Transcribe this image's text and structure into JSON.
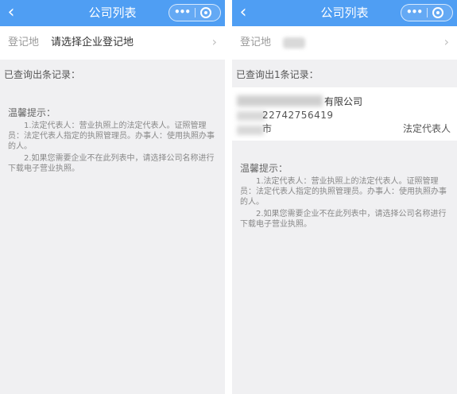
{
  "screens": [
    {
      "nav": {
        "title": "公司列表",
        "more_icon": "•••"
      },
      "registration": {
        "label": "登记地",
        "value": "请选择企业登记地"
      },
      "query_count": "已查询出条记录：",
      "tip": {
        "title": "温馨提示：",
        "lines": [
          "1.法定代表人：营业执照上的法定代表人。证照管理员：法定代表人指定的执照管理员。办事人：使用执照办事的人。",
          "2.如果您需要企业不在此列表中，请选择公司名称进行下载电子营业执照。"
        ]
      }
    },
    {
      "nav": {
        "title": "公司列表",
        "more_icon": "•••"
      },
      "registration": {
        "label": "登记地"
      },
      "query_count": "已查询出1条记录：",
      "result": {
        "name": "有限公司",
        "code": "22742756419",
        "city": "市",
        "role": "法定代表人"
      },
      "tip": {
        "title": "温馨提示：",
        "lines": [
          "1.法定代表人：营业执照上的法定代表人。证照管理员：法定代表人指定的执照管理员。办事人：使用执照办事的人。",
          "2.如果您需要企业不在此列表中，请选择公司名称进行下载电子营业执照。"
        ]
      }
    }
  ]
}
